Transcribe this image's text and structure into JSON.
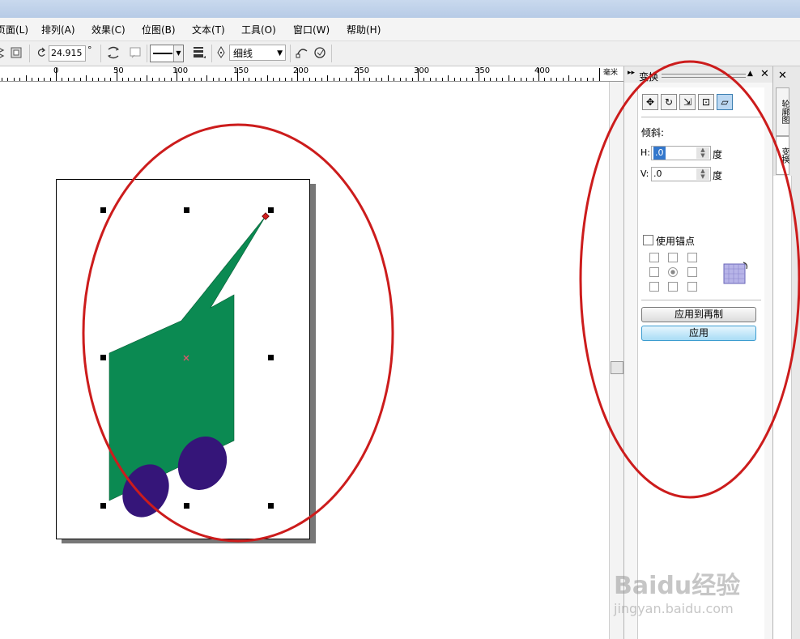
{
  "menu": [
    "页面(L)",
    "排列(A)",
    "效果(C)",
    "位图(B)",
    "文本(T)",
    "工具(O)",
    "窗口(W)",
    "帮助(H)"
  ],
  "toolbar": {
    "rotation_value": "24.915",
    "degree_symbol": "°",
    "outline_width": "细线"
  },
  "ruler": {
    "labels": [
      "0",
      "50",
      "100",
      "150",
      "200",
      "250",
      "300",
      "350",
      "400"
    ],
    "unit": "毫米"
  },
  "docker": {
    "title": "变换",
    "pin": "▸▸",
    "collapse": "▲",
    "close": "✕",
    "section": "倾斜:",
    "h_label": "H:",
    "h_value": ".0",
    "v_label": "V:",
    "v_value": ".0",
    "unit_h": "度",
    "unit_v": "度",
    "anchor_label": "使用锚点",
    "apply_dup_label": "应用到再制",
    "apply_label": "应用"
  },
  "side_tabs": [
    "轮廓图",
    "变换"
  ],
  "watermark": {
    "brand": "Baidu经验",
    "url": "jingyan.baidu.com"
  },
  "colors": {
    "green_shape": "#0b8a52",
    "blue_ellipse": "#351579",
    "annotation_circle": "#cc1c1c",
    "selected_node": "#d21f1f"
  }
}
